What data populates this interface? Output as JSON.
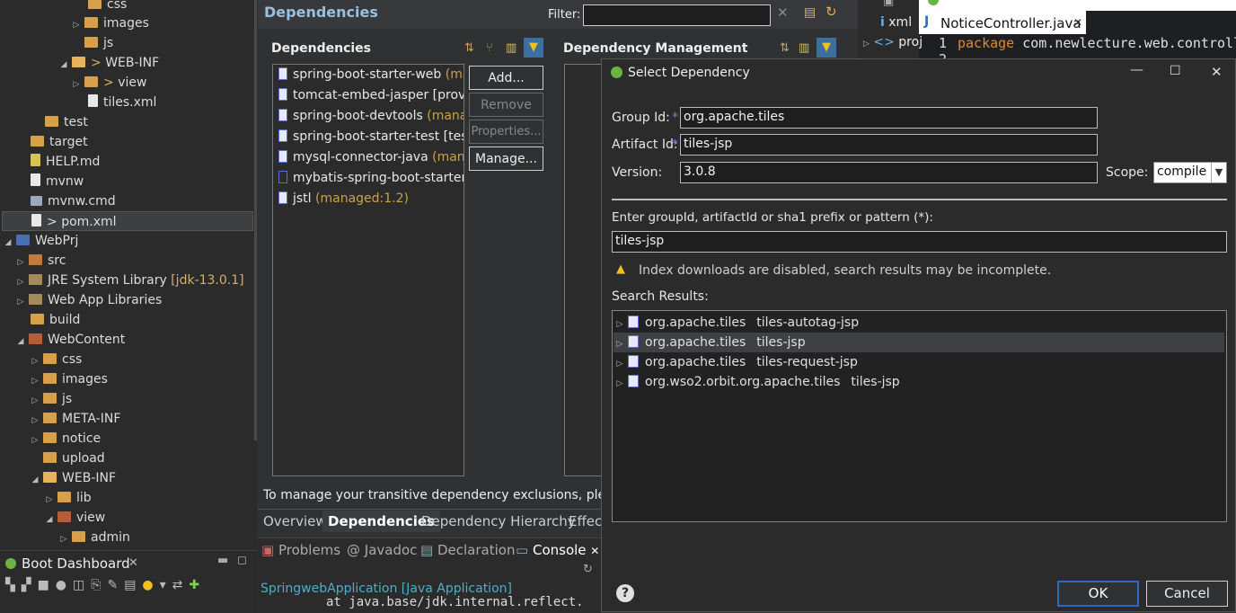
{
  "explorer": {
    "items": [
      {
        "label": "css",
        "decor": ""
      },
      {
        "label": "images",
        "decor": ""
      },
      {
        "label": "js",
        "decor": ""
      },
      {
        "label": "WEB-INF",
        "decor": ">"
      },
      {
        "label": "view",
        "decor": ">"
      },
      {
        "label": "tiles.xml",
        "decor": ""
      },
      {
        "label": "test",
        "decor": ""
      },
      {
        "label": "target",
        "decor": ""
      },
      {
        "label": "HELP.md",
        "decor": ""
      },
      {
        "label": "mvnw",
        "decor": ""
      },
      {
        "label": "mvnw.cmd",
        "decor": ""
      },
      {
        "label": "pom.xml",
        "decor": ">"
      },
      {
        "label": "WebPrj",
        "decor": ""
      },
      {
        "label": "src",
        "decor": ""
      },
      {
        "label": "JRE System Library",
        "decor": "[jdk-13.0.1]"
      },
      {
        "label": "Web App Libraries",
        "decor": ""
      },
      {
        "label": "build",
        "decor": ""
      },
      {
        "label": "WebContent",
        "decor": ""
      },
      {
        "label": "css",
        "decor": ""
      },
      {
        "label": "images",
        "decor": ""
      },
      {
        "label": "js",
        "decor": ""
      },
      {
        "label": "META-INF",
        "decor": ""
      },
      {
        "label": "notice",
        "decor": ""
      },
      {
        "label": "upload",
        "decor": ""
      },
      {
        "label": "WEB-INF",
        "decor": ""
      },
      {
        "label": "lib",
        "decor": ""
      },
      {
        "label": "view",
        "decor": ""
      },
      {
        "label": "admin",
        "decor": ""
      }
    ]
  },
  "boot": {
    "title": "Boot Dashboard"
  },
  "pom": {
    "header_title": "Dependencies",
    "filter_label": "Filter:",
    "filter_value": "",
    "dependencies_title": "Dependencies",
    "dependencies": [
      {
        "name": "spring-boot-starter-web",
        "extra": "(mar"
      },
      {
        "name": "tomcat-embed-jasper",
        "extra": "[provid"
      },
      {
        "name": "spring-boot-devtools",
        "extra": "(manag"
      },
      {
        "name": "spring-boot-starter-test",
        "extra": "[test]"
      },
      {
        "name": "mysql-connector-java",
        "extra": "(manag"
      },
      {
        "name": "mybatis-spring-boot-starter",
        "extra": ":"
      },
      {
        "name": "jstl",
        "extra": "(managed:1.2)"
      }
    ],
    "buttons": {
      "add": "Add...",
      "remove": "Remove",
      "properties": "Properties...",
      "manage": "Manage..."
    },
    "mgmt_title": "Dependency Management",
    "exclusion_text": "To manage your transitive dependency exclusions, please us",
    "tabs": [
      "Overview",
      "Dependencies",
      "Dependency Hierarchy",
      "Effect"
    ]
  },
  "console": {
    "tabs": [
      "Problems",
      "@ Javadoc",
      "Declaration",
      "Console"
    ],
    "launch": "SpringwebApplication [Java Application]",
    "line": "at java.base/jdk.internal.reflect."
  },
  "editor": {
    "outline_items": [
      "xml",
      "proj"
    ],
    "tab_title": "NoticeController.java",
    "line_no": "1",
    "keyword": "package",
    "code": "com.newlecture.web.controll",
    "line_no2": "2"
  },
  "dialog": {
    "title": "Select Dependency",
    "group_label": "Group Id:",
    "group_value": "org.apache.tiles",
    "artifact_label": "Artifact Id:",
    "artifact_value": "tiles-jsp",
    "version_label": "Version:",
    "version_value": "3.0.8",
    "scope_label": "Scope:",
    "scope_value": "compile",
    "required_mark": "*",
    "search_label": "Enter groupId, artifactId or sha1 prefix or pattern (*):",
    "search_value": "tiles-jsp",
    "warning": "Index downloads are disabled, search results may be incomplete.",
    "results_label": "Search Results:",
    "results": [
      {
        "group": "org.apache.tiles",
        "artifact": "tiles-autotag-jsp"
      },
      {
        "group": "org.apache.tiles",
        "artifact": "tiles-jsp"
      },
      {
        "group": "org.apache.tiles",
        "artifact": "tiles-request-jsp"
      },
      {
        "group": "org.wso2.orbit.org.apache.tiles",
        "artifact": "tiles-jsp"
      }
    ],
    "ok": "OK",
    "cancel": "Cancel"
  },
  "colors": {
    "accent": "#2a6bbf",
    "managed": "#c9a24a",
    "spring": "#6db33f"
  }
}
